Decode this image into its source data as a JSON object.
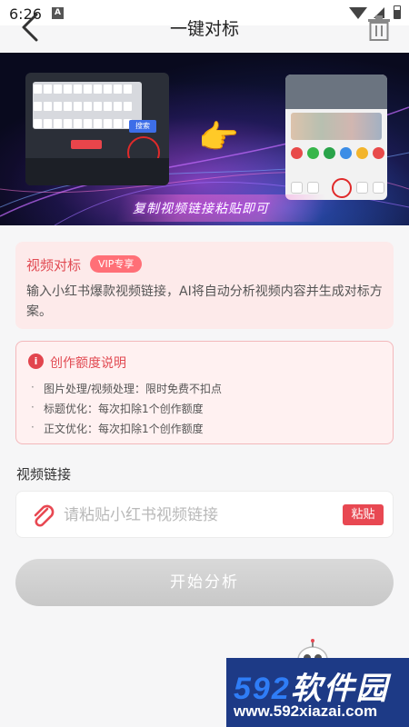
{
  "status_bar": {
    "time": "6:26",
    "app_icon_letter": "A"
  },
  "header": {
    "title": "一键对标"
  },
  "banner": {
    "caption": "复制视频链接粘贴即可",
    "keyboard_go_key": "搜索"
  },
  "intro_card": {
    "heading": "视频对标",
    "badge": "VIP专享",
    "description": "输入小红书爆款视频链接，AI将自动分析视频内容并生成对标方案。"
  },
  "quota_card": {
    "heading": "创作额度说明",
    "items": [
      "图片处理/视频处理：限时免费不扣点",
      "标题优化：每次扣除1个创作额度",
      "正文优化：每次扣除1个创作额度"
    ]
  },
  "link_section": {
    "label": "视频链接",
    "placeholder": "请粘贴小红书视频链接",
    "value": "",
    "paste_label": "粘贴"
  },
  "start_button": {
    "label": "开始分析"
  },
  "watermark": {
    "brand_digits": "592",
    "brand_text": "软件园",
    "url": "www.592xiazai.com"
  },
  "colors": {
    "accent": "#e84852",
    "card_bg": "#fdeaea",
    "disabled_button": "#cccccc"
  }
}
